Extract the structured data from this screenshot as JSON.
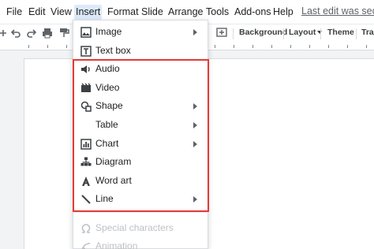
{
  "menubar": {
    "items": [
      "File",
      "Edit",
      "View",
      "Insert",
      "Format",
      "Slide",
      "Arrange",
      "Tools",
      "Add-ons",
      "Help"
    ],
    "last_edit": "Last edit was seco"
  },
  "toolbar": {
    "background": "Background",
    "layout": "Layout",
    "theme": "Theme",
    "transition": "Tran"
  },
  "insert_menu": {
    "items": [
      {
        "label": "Image",
        "icon": "image-icon",
        "submenu": true,
        "enabled": true
      },
      {
        "label": "Text box",
        "icon": "text-box-icon",
        "submenu": false,
        "enabled": true
      },
      {
        "label": "Audio",
        "icon": "audio-icon",
        "submenu": false,
        "enabled": true
      },
      {
        "label": "Video",
        "icon": "video-icon",
        "submenu": false,
        "enabled": true
      },
      {
        "label": "Shape",
        "icon": "shape-icon",
        "submenu": true,
        "enabled": true
      },
      {
        "label": "Table",
        "icon": "",
        "submenu": true,
        "enabled": true
      },
      {
        "label": "Chart",
        "icon": "chart-icon",
        "submenu": true,
        "enabled": true
      },
      {
        "label": "Diagram",
        "icon": "diagram-icon",
        "submenu": false,
        "enabled": true
      },
      {
        "label": "Word art",
        "icon": "word-art-icon",
        "submenu": false,
        "enabled": true
      },
      {
        "label": "Line",
        "icon": "line-icon",
        "submenu": true,
        "enabled": true
      },
      {
        "label": "Special characters",
        "icon": "omega-icon",
        "submenu": false,
        "enabled": false
      },
      {
        "label": "Animation",
        "icon": "animation-icon",
        "submenu": false,
        "enabled": false
      }
    ]
  },
  "colors": {
    "highlight_border": "#e53935",
    "active_menu_bg": "#ddeaf9"
  }
}
